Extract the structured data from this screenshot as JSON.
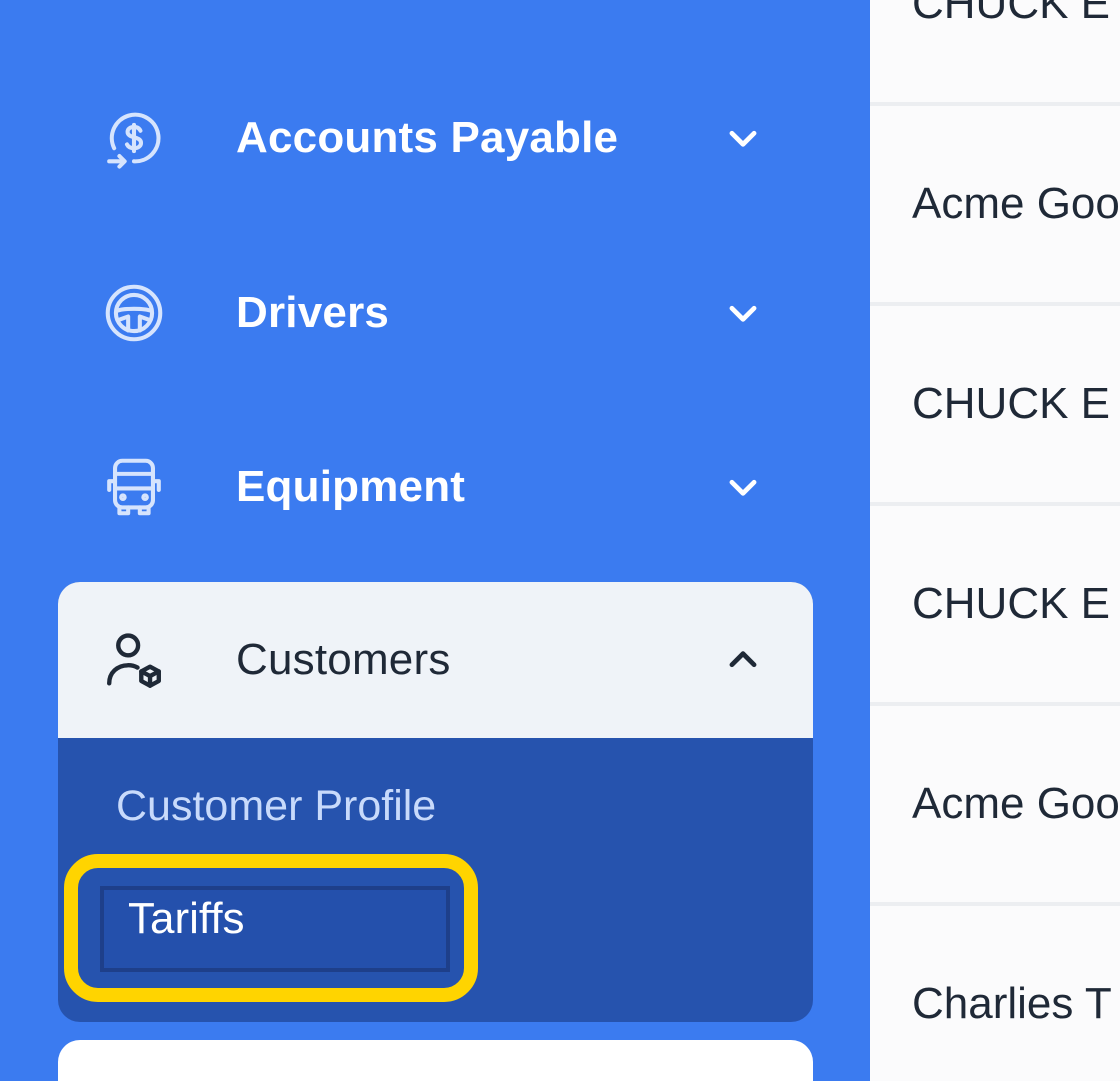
{
  "sidebar": {
    "items": [
      {
        "label": "Accounts Payable",
        "icon": "dollar-refresh-icon",
        "expanded": false
      },
      {
        "label": "Drivers",
        "icon": "steering-wheel-icon",
        "expanded": false
      },
      {
        "label": "Equipment",
        "icon": "truck-icon",
        "expanded": false
      }
    ],
    "group": {
      "label": "Customers",
      "icon": "user-box-icon",
      "expanded": true,
      "sub_items": [
        {
          "label": "Customer Profile",
          "active": false
        },
        {
          "label": "Tariffs",
          "active": true,
          "highlighted": true
        }
      ]
    }
  },
  "table": {
    "rows": [
      "CHUCK E",
      "Acme Goo",
      "CHUCK E",
      "CHUCK E",
      "Acme Goo",
      "Charlies T"
    ]
  },
  "colors": {
    "sidebar_bg": "#3b7bf0",
    "group_bg": "#2653ae",
    "group_head_bg": "#eff3f8",
    "highlight": "#ffd400",
    "content_bg": "#fbfbfc"
  }
}
